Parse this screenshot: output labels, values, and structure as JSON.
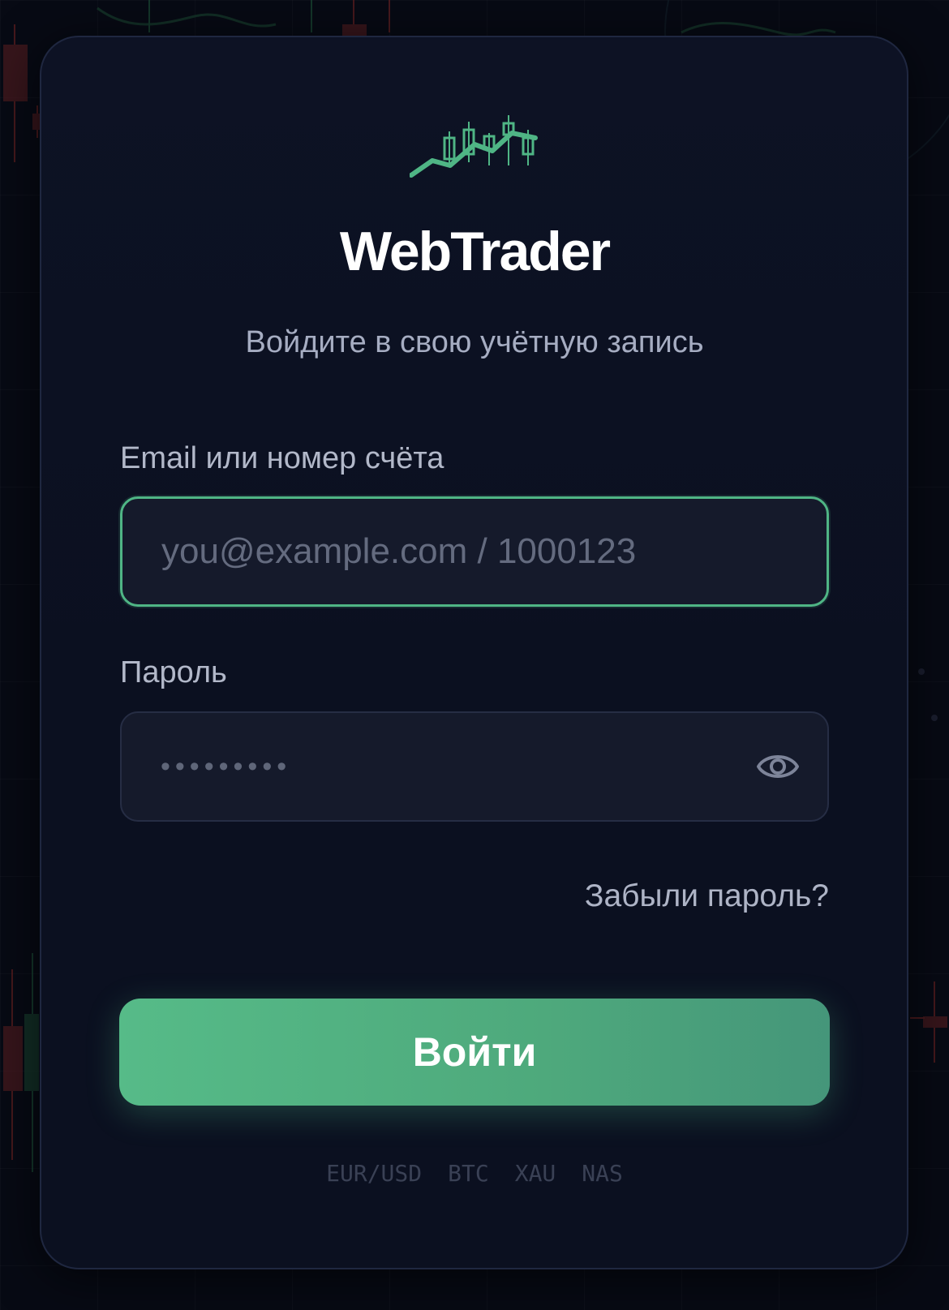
{
  "brand": {
    "name": "WebTrader",
    "logo_icon": "candlestick-chart-icon"
  },
  "subtitle": "Войдите в свою учётную запись",
  "form": {
    "email": {
      "label": "Email или номер счёта",
      "value": "",
      "placeholder": "you@example.com / 1000123"
    },
    "password": {
      "label": "Пароль",
      "value": "",
      "placeholder": "•••••••••",
      "toggle_icon": "eye-icon"
    },
    "forgot_link": "Забыли пароль?",
    "submit_label": "Войти"
  },
  "tickers": [
    "EUR/USD",
    "BTC",
    "XAU",
    "NAS"
  ],
  "colors": {
    "accent": "#4fb585",
    "background": "#070a14",
    "card": "#0b1020",
    "bull_candle": "#2c7a52",
    "bear_candle": "#8a2a2a"
  }
}
